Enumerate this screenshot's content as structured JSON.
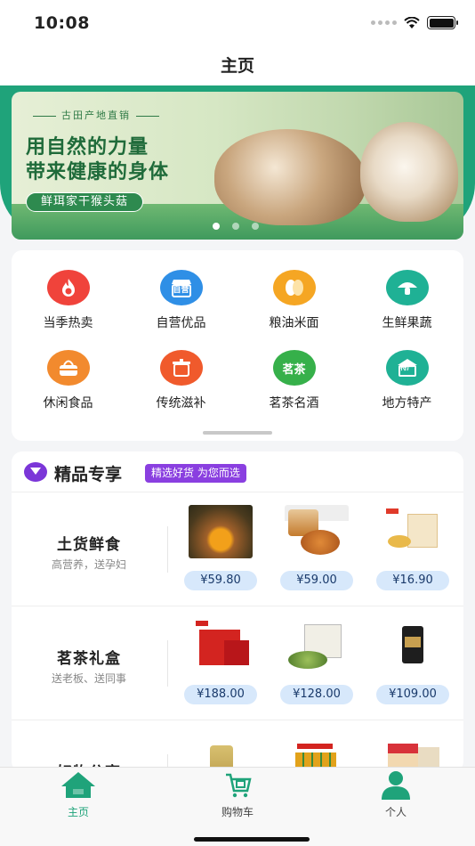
{
  "status_bar": {
    "time": "10:08"
  },
  "navbar": {
    "title": "主页"
  },
  "banner": {
    "subtitle": "古田产地直销",
    "headline_1": "用自然的力量",
    "headline_2": "带来健康的身体",
    "product": "鲜珥家干猴头菇",
    "pages": 3,
    "active_page": 1
  },
  "categories": [
    {
      "label": "当季热卖",
      "icon": "flame-icon",
      "color": "#f0433b"
    },
    {
      "label": "自营优品",
      "icon": "shop-icon",
      "color": "#2f8fe6",
      "badge": "自营"
    },
    {
      "label": "粮油米面",
      "icon": "grain-icon",
      "color": "#f5a623"
    },
    {
      "label": "生鲜果蔬",
      "icon": "mushroom-icon",
      "color": "#1fb195"
    },
    {
      "label": "休闲食品",
      "icon": "basket-icon",
      "color": "#f28a2e"
    },
    {
      "label": "传统滋补",
      "icon": "pot-icon",
      "color": "#f05a2c"
    },
    {
      "label": "茗茶名酒",
      "icon": "tea-icon",
      "color": "#36b04a",
      "badge": "茗茶"
    },
    {
      "label": "地方特产",
      "icon": "specialty-icon",
      "color": "#1fb195",
      "badge": "特产"
    }
  ],
  "premium": {
    "title": "精品专享",
    "tag": "精选好货 为您而选",
    "rows": [
      {
        "name": "土货鲜食",
        "desc": "高营养，送孕妇",
        "prices": [
          "¥59.80",
          "¥59.00",
          "¥16.90"
        ]
      },
      {
        "name": "茗茶礼盒",
        "desc": "送老板、送同事",
        "prices": [
          "¥188.00",
          "¥128.00",
          "¥109.00"
        ]
      },
      {
        "name": "好物分享",
        "desc": "",
        "prices": [
          "",
          "",
          ""
        ]
      }
    ]
  },
  "tabbar": [
    {
      "label": "主页",
      "icon": "home-icon",
      "active": true
    },
    {
      "label": "购物车",
      "icon": "cart-icon",
      "active": false
    },
    {
      "label": "个人",
      "icon": "person-icon",
      "active": false
    }
  ]
}
